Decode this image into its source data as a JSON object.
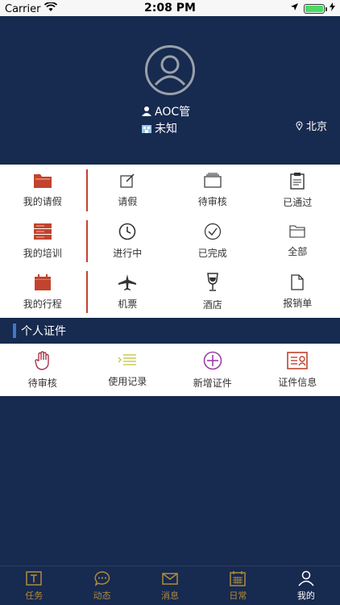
{
  "status_bar": {
    "carrier": "Carrier",
    "time": "2:08 PM"
  },
  "profile": {
    "name": "AOC管",
    "dept": "未知",
    "location": "北京"
  },
  "rows": [
    {
      "section_label": "我的请假",
      "items": [
        "请假",
        "待审核",
        "已通过"
      ]
    },
    {
      "section_label": "我的培训",
      "items": [
        "进行中",
        "已完成",
        "全部"
      ]
    },
    {
      "section_label": "我的行程",
      "items": [
        "机票",
        "酒店",
        "报销单"
      ]
    }
  ],
  "certificates": {
    "title": "个人证件",
    "items": [
      "待审核",
      "使用记录",
      "新增证件",
      "证件信息"
    ]
  },
  "tabbar": {
    "items": [
      "任务",
      "动态",
      "消息",
      "日常",
      "我的"
    ],
    "active": 4
  },
  "colors": {
    "navy": "#172a4f",
    "accent_red": "#c0442e",
    "tab_gold": "#b08b3d",
    "section_bar": "#3e78c8"
  }
}
